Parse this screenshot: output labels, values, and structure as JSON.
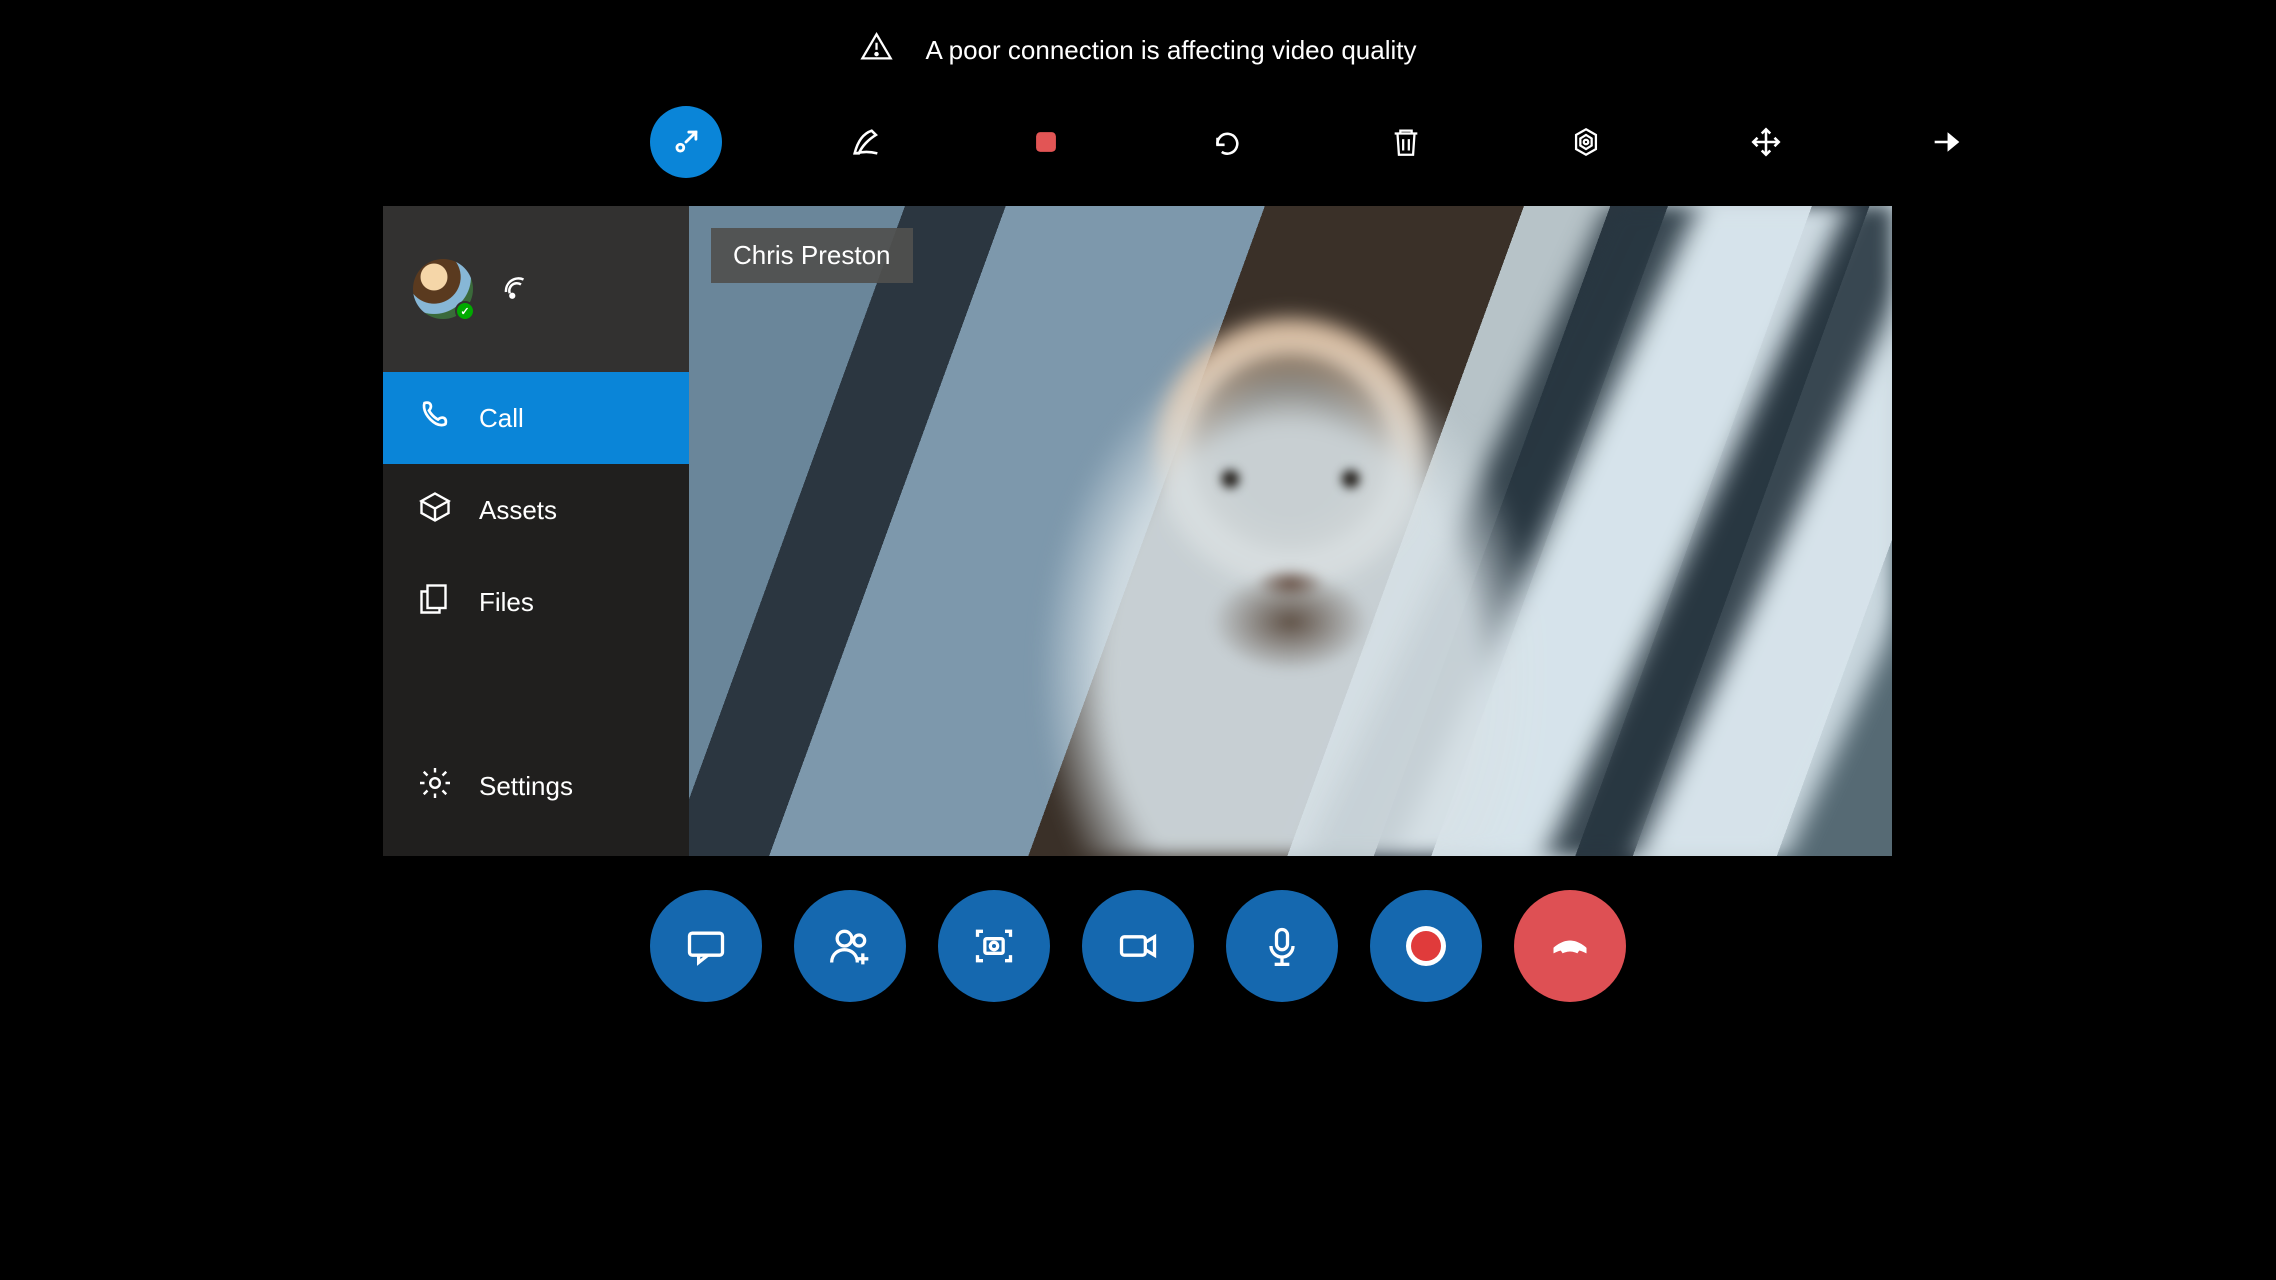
{
  "warning": {
    "text": "A poor connection is affecting video quality"
  },
  "participant": {
    "name": "Chris Preston"
  },
  "sidebar": {
    "items": [
      {
        "key": "call",
        "label": "Call",
        "active": true
      },
      {
        "key": "assets",
        "label": "Assets",
        "active": false
      },
      {
        "key": "files",
        "label": "Files",
        "active": false
      },
      {
        "key": "settings",
        "label": "Settings",
        "active": false
      }
    ]
  },
  "top_toolbar": {
    "items": [
      "pointer",
      "draw",
      "stop-record",
      "undo",
      "delete",
      "focus",
      "expand",
      "pin"
    ]
  },
  "call_controls": {
    "items": [
      "chat",
      "add-participants",
      "snapshot",
      "video",
      "mic",
      "record",
      "end-call"
    ]
  }
}
